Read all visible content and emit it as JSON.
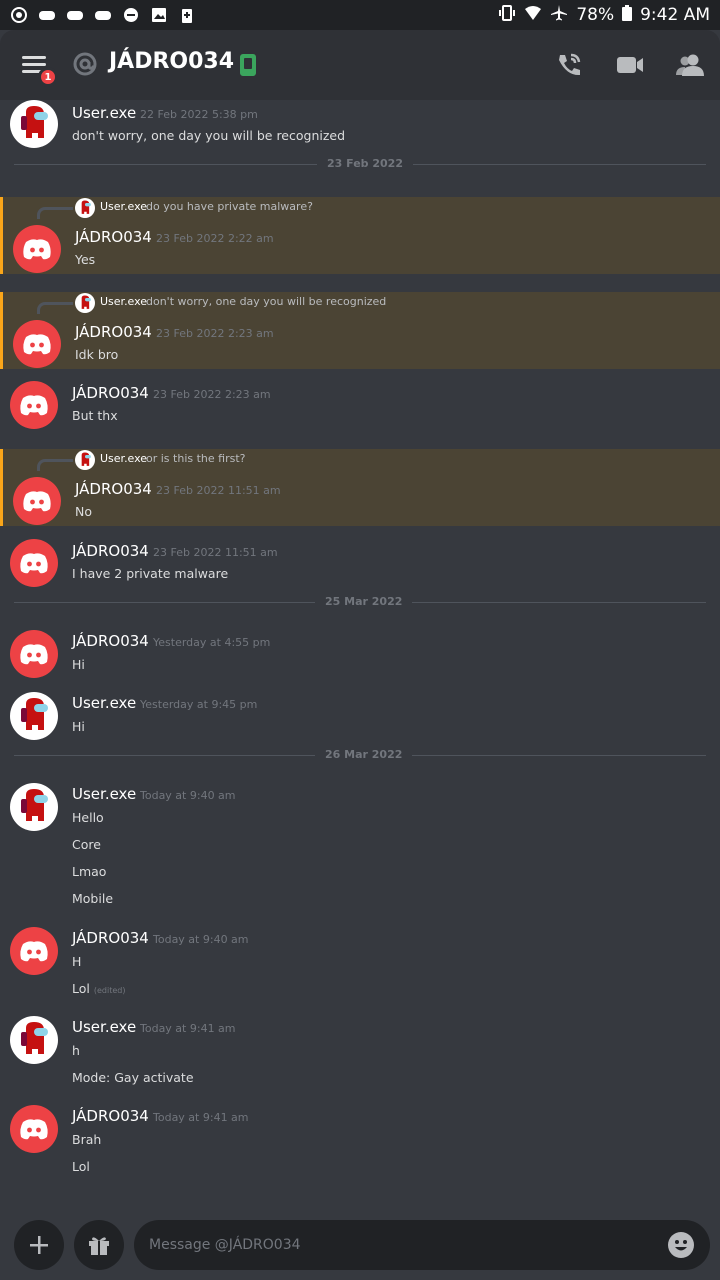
{
  "status": {
    "battery": "78%",
    "time": "9:42 AM"
  },
  "header": {
    "title": "JÁDRO034",
    "badge_count": "1"
  },
  "dividers": [
    "23 Feb 2022",
    "25 Mar 2022",
    "26 Mar 2022"
  ],
  "messages": [
    {
      "user": "User.exe",
      "ts": "22 Feb 2022 5:38 pm",
      "lines": [
        "don't worry, one day you will be recognized"
      ]
    },
    {
      "reply_user": "User.exe",
      "reply_text": "do you have private malware?",
      "user": "JÁDRO034",
      "ts": "23 Feb 2022 2:22 am",
      "lines": [
        "Yes"
      ]
    },
    {
      "reply_user": "User.exe",
      "reply_text": "don't worry, one day you will be recognized",
      "user": "JÁDRO034",
      "ts": "23 Feb 2022 2:23 am",
      "lines": [
        "Idk bro"
      ]
    },
    {
      "user": "JÁDRO034",
      "ts": "23 Feb 2022 2:23 am",
      "lines": [
        "But thx"
      ]
    },
    {
      "reply_user": "User.exe",
      "reply_text": "or is this the first?",
      "user": "JÁDRO034",
      "ts": "23 Feb 2022 11:51 am",
      "lines": [
        "No"
      ]
    },
    {
      "user": "JÁDRO034",
      "ts": "23 Feb 2022 11:51 am",
      "lines": [
        "I have 2 private malware"
      ]
    },
    {
      "user": "JÁDRO034",
      "ts": "Yesterday at 4:55 pm",
      "lines": [
        "Hi"
      ]
    },
    {
      "user": "User.exe",
      "ts": "Yesterday at 9:45 pm",
      "lines": [
        "Hi"
      ]
    },
    {
      "user": "User.exe",
      "ts": "Today at 9:40 am",
      "lines": [
        "Hello",
        "Core",
        "Lmao",
        "Mobile"
      ]
    },
    {
      "user": "JÁDRO034",
      "ts": "Today at 9:40 am",
      "lines": [
        "H",
        "Lol"
      ],
      "edited": "(edited)"
    },
    {
      "user": "User.exe",
      "ts": "Today at 9:41 am",
      "lines": [
        "h",
        "Mode: Gay activate"
      ]
    },
    {
      "user": "JÁDRO034",
      "ts": "Today at 9:41 am",
      "lines": [
        "Brah",
        "Lol"
      ]
    }
  ],
  "composer": {
    "placeholder": "Message @JÁDRO034"
  }
}
